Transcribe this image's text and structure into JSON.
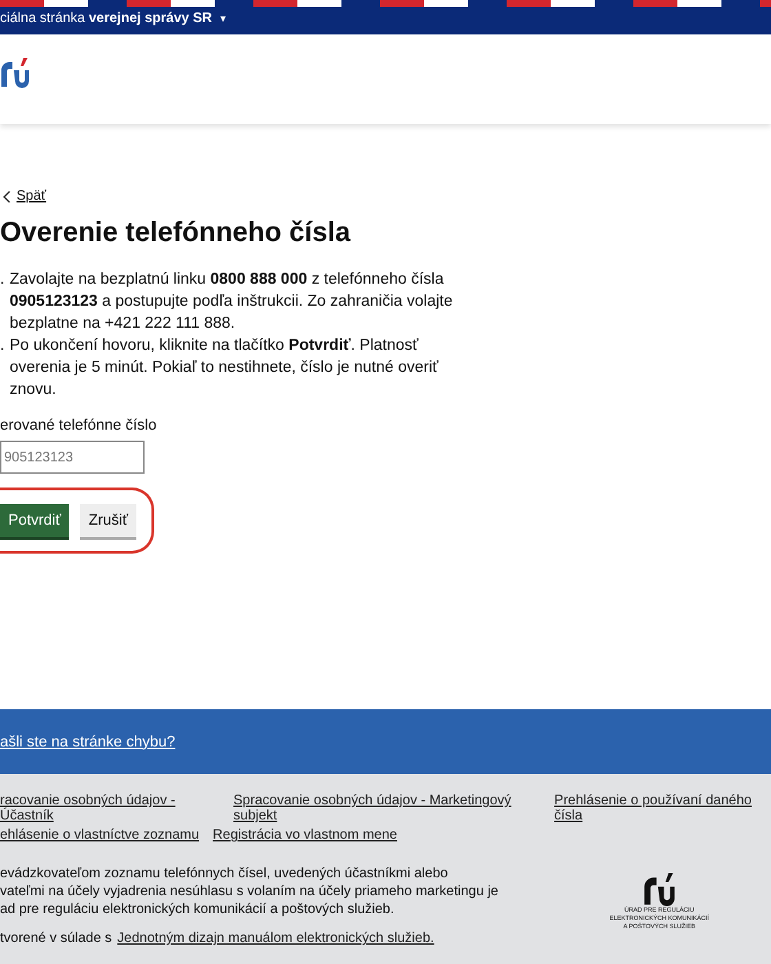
{
  "top_bar": {
    "text": "ciálna stránka **verejnej správy SR**",
    "caret": "▾"
  },
  "back_link": "Späť",
  "title": "Overenie telefónneho čísla",
  "steps": [
    {
      "marker": ".",
      "text": "Zavolajte na bezplatnú linku **0800 888 000** z telefónneho čísla **0905123123** a postupujte podľa inštrukcii. Zo zahraničia volajte bezplatne na +421 222 111 888."
    },
    {
      "marker": ".",
      "text": "Po ukončení hovoru, kliknite na tlačítko **Potvrdiť**. Platnosť overenia je 5 minút. Pokiaľ to nestihnete, číslo je nutné overiť znovu."
    }
  ],
  "phone_field": {
    "label": "erované telefónne číslo",
    "placeholder": "905123123"
  },
  "buttons": [
    {
      "label": "Potvrdiť",
      "kind": "primary"
    },
    {
      "label": "Zrušiť",
      "kind": "secondary"
    }
  ],
  "highlighted": true,
  "feedback_link": "ašli ste na stránke chybu?",
  "footer": {
    "links": [
      [
        "racovanie osobných údajov - Účastník",
        "Spracovanie osobných údajov - Marketingový subjekt",
        "Prehlásenie o používaní daného čísla"
      ],
      [
        "ehlásenie o vlastníctve zoznamu",
        "Registrácia vo vlastnom mene"
      ]
    ],
    "lines": [
      "evádzkovateľom zoznamu telefónnych čísel, uvedených účastníkmi alebo",
      "vateľmi na účely vyjadrenia nesúhlasu s volaním na účely priameho marketingu je",
      "ad pre reguláciu elektronických komunikácií a poštových služieb."
    ],
    "made_with": "tvorené v súlade s",
    "made_with_link": "Jednotným dizajn manuálom elektronických služieb.",
    "logo_text": [
      "ÚRAD PRE REGULÁCIU",
      "ELEKTRONICKÝCH KOMUNIKÁCIÍ",
      "A POŠTOVÝCH SLUŽIEB"
    ]
  }
}
